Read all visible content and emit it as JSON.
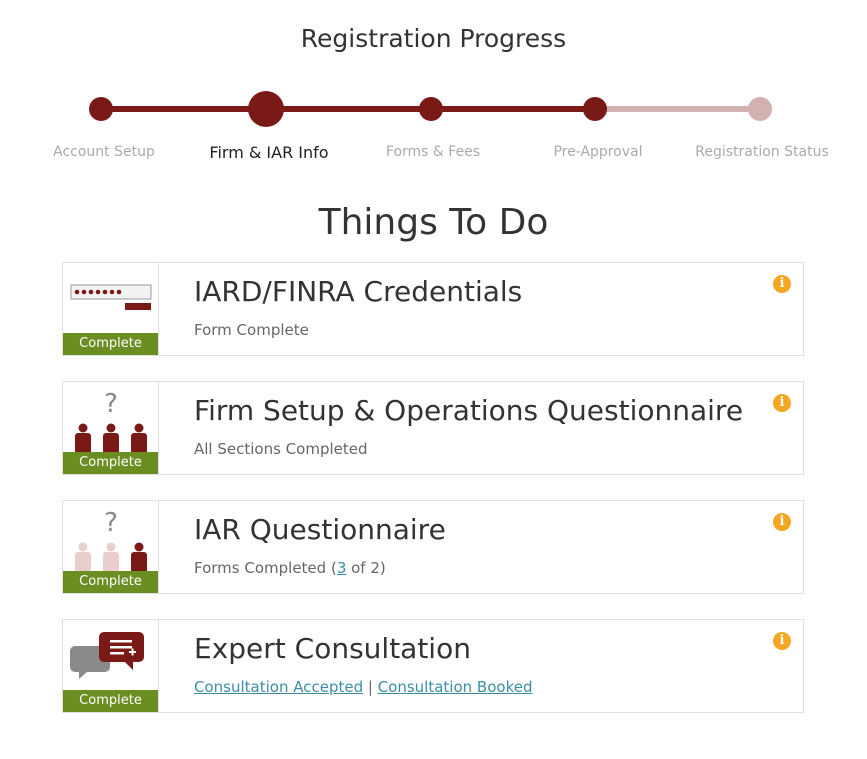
{
  "progress": {
    "title": "Registration Progress",
    "steps": [
      {
        "label": "Account Setup"
      },
      {
        "label": "Firm & IAR Info"
      },
      {
        "label": "Forms & Fees"
      },
      {
        "label": "Pre-Approval"
      },
      {
        "label": "Registration Status"
      }
    ],
    "active_step": 1,
    "completed_through": 3,
    "colors": {
      "done": "#7a1a17",
      "todo": "#d1b2b1"
    }
  },
  "todo": {
    "title": "Things To Do",
    "cards": [
      {
        "title": "IARD/FINRA Credentials",
        "status": "Complete",
        "subtitle": "Form Complete",
        "icon": "credentials-icon"
      },
      {
        "title": "Firm Setup & Operations Questionnaire",
        "status": "Complete",
        "subtitle": "All Sections Completed",
        "icon": "group-question-icon"
      },
      {
        "title": "IAR Questionnaire",
        "status": "Complete",
        "subtitle_prefix": "Forms Completed (",
        "subtitle_link": "3",
        "subtitle_suffix": " of 2)",
        "icon": "person-question-icon"
      },
      {
        "title": "Expert Consultation",
        "status": "Complete",
        "link1": "Consultation Accepted",
        "separator": " | ",
        "link2": "Consultation Booked",
        "icon": "chat-icon"
      }
    ],
    "info_symbol": "i",
    "badge_color": "#6b8e23",
    "link_color": "#3a8fa5",
    "info_color": "#f5a623"
  }
}
